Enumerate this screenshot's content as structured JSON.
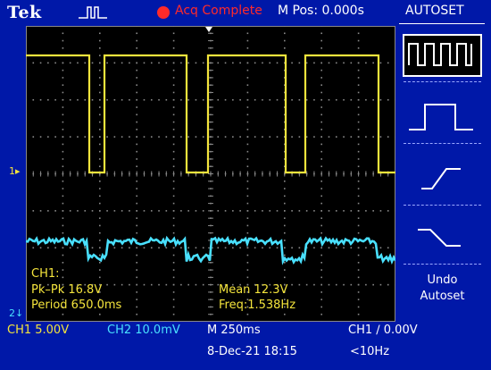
{
  "header": {
    "brand": "Tek",
    "acq_status": "Acq Complete",
    "horizontal_position": "M Pos: 0.000s"
  },
  "side_menu": {
    "title": "AUTOSET",
    "options": [
      {
        "name": "multi-cycle",
        "icon": "multi-cycle-square-wave-icon",
        "selected": true
      },
      {
        "name": "single-cycle",
        "icon": "single-cycle-pulse-icon",
        "selected": false
      },
      {
        "name": "rising-edge",
        "icon": "rising-edge-icon",
        "selected": false
      },
      {
        "name": "falling-edge",
        "icon": "falling-edge-icon",
        "selected": false
      }
    ],
    "undo_line1": "Undo",
    "undo_line2": "Autoset"
  },
  "measurements": {
    "channel": "CH1:",
    "pk_pk": "Pk–Pk 16.8V",
    "period": "Period 650.0ms",
    "mean": "Mean 12.3V",
    "freq": "Freq:1.538Hz"
  },
  "markers": {
    "ch1": "1",
    "ch2": "2"
  },
  "status_bar": {
    "ch1_scale": "CH1  5.00V",
    "ch2_scale": "CH2  10.0mV",
    "timebase": "M 250ms",
    "trigger": "CH1 ∕ 0.00V",
    "datetime": "8-Dec-21 18:15",
    "trigger_freq": "<10Hz"
  },
  "colors": {
    "background": "#0018a8",
    "ch1_trace": "#f4e43c",
    "ch2_trace": "#49e0ff",
    "status_red": "#ff2a2a"
  }
}
